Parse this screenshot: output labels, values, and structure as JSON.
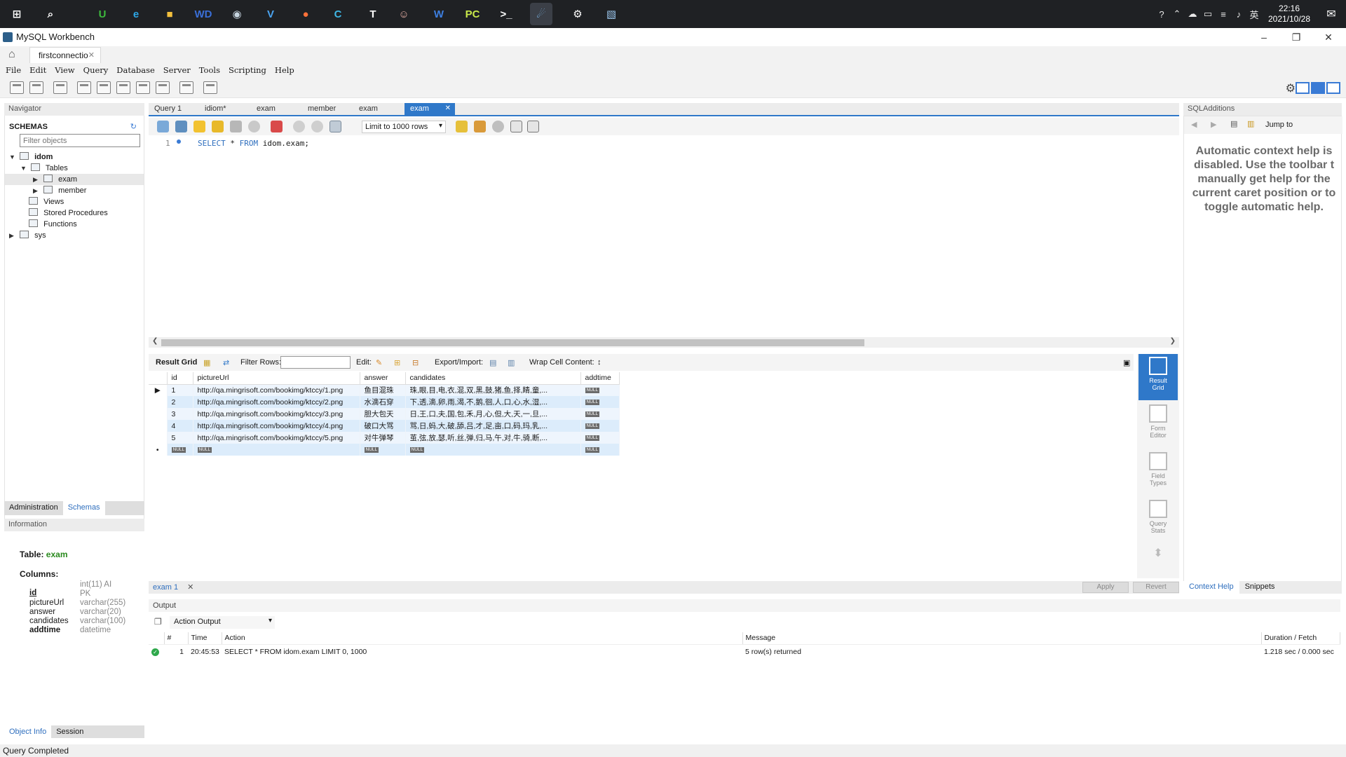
{
  "taskbar": {
    "clock_time": "22:16",
    "clock_date": "2021/10/28",
    "ime_label": "英",
    "apps": [
      {
        "name": "start",
        "glyph": "⊞",
        "color": "#ffffff"
      },
      {
        "name": "search",
        "glyph": "⌕",
        "color": "#ffffff"
      },
      {
        "name": "upwork",
        "glyph": "U",
        "color": "#3dbb3d"
      },
      {
        "name": "edge",
        "glyph": "e",
        "color": "#2da8e8"
      },
      {
        "name": "explorer",
        "glyph": "■",
        "color": "#f3c03d"
      },
      {
        "name": "wd",
        "glyph": "WD",
        "color": "#3a6fd8"
      },
      {
        "name": "steam",
        "glyph": "◉",
        "color": "#c7d5e0"
      },
      {
        "name": "vscode",
        "glyph": "V",
        "color": "#4aa4f0"
      },
      {
        "name": "firefox",
        "glyph": "●",
        "color": "#ff7139"
      },
      {
        "name": "c-app",
        "glyph": "C",
        "color": "#3fb8e6"
      },
      {
        "name": "typora",
        "glyph": "T",
        "color": "#ffffff"
      },
      {
        "name": "photo",
        "glyph": "☺",
        "color": "#e7b0a6"
      },
      {
        "name": "wps",
        "glyph": "W",
        "color": "#3d7fe0"
      },
      {
        "name": "pycharm",
        "glyph": "PC",
        "color": "#c9e94a"
      },
      {
        "name": "terminal",
        "glyph": ">_",
        "color": "#ffffff"
      },
      {
        "name": "workbench",
        "glyph": "☄",
        "color": "#7ab7e8"
      },
      {
        "name": "settings",
        "glyph": "⚙",
        "color": "#ffffff"
      },
      {
        "name": "app",
        "glyph": "▧",
        "color": "#9cc8ef"
      }
    ]
  },
  "window": {
    "title": "MySQL Workbench",
    "connection_tab": "firstconnectio"
  },
  "menu": [
    "File",
    "Edit",
    "View",
    "Query",
    "Database",
    "Server",
    "Tools",
    "Scripting",
    "Help"
  ],
  "navigator": {
    "header": "Navigator",
    "schemas_label": "SCHEMAS",
    "filter_placeholder": "Filter objects",
    "tree": {
      "schema1": "idom",
      "tables": "Tables",
      "table1": "exam",
      "table2": "member",
      "views": "Views",
      "procedures": "Stored Procedures",
      "functions": "Functions",
      "schema2": "sys"
    },
    "tabs": {
      "admin": "Administration",
      "schemas": "Schemas"
    }
  },
  "information": {
    "header": "Information",
    "table_label": "Table:",
    "table_name": "exam",
    "columns_label": "Columns:",
    "columns": [
      {
        "name": "id",
        "type": "int(11) AI",
        "type2": "PK"
      },
      {
        "name": "pictureUrl",
        "type": "varchar(255)"
      },
      {
        "name": "answer",
        "type": "varchar(20)"
      },
      {
        "name": "candidates",
        "type": "varchar(100)"
      },
      {
        "name": "addtime",
        "type": "datetime"
      }
    ],
    "tabs": {
      "object_info": "Object Info",
      "session": "Session"
    }
  },
  "query_tabs": [
    "Query 1",
    "idiom*",
    "exam",
    "member",
    "exam",
    "exam"
  ],
  "editor": {
    "limit": "Limit to 1000 rows",
    "line_number": "1",
    "sql_keyword1": "SELECT",
    "sql_star": " * ",
    "sql_keyword2": "FROM",
    "sql_rest": " idom.exam;"
  },
  "result_toolbar": {
    "result_grid": "Result Grid",
    "filter_rows": "Filter Rows:",
    "edit": "Edit:",
    "export_import": "Export/Import:",
    "wrap": "Wrap Cell Content:"
  },
  "grid": {
    "columns": [
      "id",
      "pictureUrl",
      "answer",
      "candidates",
      "addtime"
    ],
    "rows": [
      [
        "1",
        "http://qa.mingrisoft.com/bookimg/ktccy/1.png",
        "鱼目混珠",
        "珠,眼,目,电,衣,混,双,黑,鼓,猪,鱼,择,睛,童,..."
      ],
      [
        "2",
        "http://qa.mingrisoft.com/bookimg/ktccy/2.png",
        "水滴石穿",
        "下,透,滴,卵,雨,渴,不,鹅,徊,人,口,心,水,湿,..."
      ],
      [
        "3",
        "http://qa.mingrisoft.com/bookimg/ktccy/3.png",
        "胆大包天",
        "日,王,口,夫,国,包,禾,月,心,但,大,天,一,旦,..."
      ],
      [
        "4",
        "http://qa.mingrisoft.com/bookimg/ktccy/4.png",
        "破口大骂",
        "骂,日,蚂,大,破,舔,吕,才,足,亩,口,码,玛,乳,..."
      ],
      [
        "5",
        "http://qa.mingrisoft.com/bookimg/ktccy/5.png",
        "对牛弹琴",
        "茧,弦,放,瑟,听,丝,弹,归,马,午,对,牛,骑,断,..."
      ]
    ],
    "null_label": "NULL"
  },
  "side_tabs": [
    {
      "line1": "Result",
      "line2": "Grid"
    },
    {
      "line1": "Form",
      "line2": "Editor"
    },
    {
      "line1": "Field",
      "line2": "Types"
    },
    {
      "line1": "Query",
      "line2": "Stats"
    }
  ],
  "result_tab": "exam 1",
  "apply_label": "Apply",
  "revert_label": "Revert",
  "output": {
    "header": "Output",
    "selector": "Action Output",
    "columns": [
      "#",
      "Time",
      "Action",
      "Message",
      "Duration / Fetch"
    ],
    "rows": [
      {
        "num": "1",
        "time": "20:45:53",
        "action": "SELECT * FROM idom.exam LIMIT 0, 1000",
        "message": "5 row(s) returned",
        "duration": "1.218 sec / 0.000 sec"
      }
    ]
  },
  "sql_additions": {
    "header": "SQLAdditions",
    "jump_to": "Jump to",
    "help_text": "Automatic context help is disabled. Use the toolbar t manually get help for the current caret position or to toggle automatic help.",
    "tabs": {
      "context_help": "Context Help",
      "snippets": "Snippets"
    }
  },
  "status": "Query Completed"
}
